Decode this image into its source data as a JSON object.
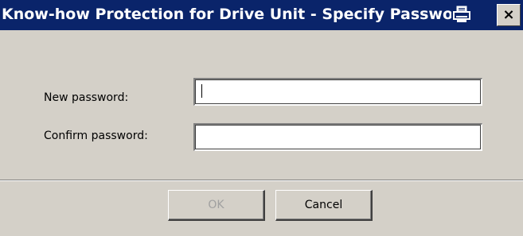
{
  "window": {
    "title": "Know-how Protection for Drive Unit - Specify Password",
    "print_icon": "printer-icon",
    "close_label": "×",
    "close_icon": "close-icon"
  },
  "form": {
    "new_password_label": "New password:",
    "new_password_value": "",
    "confirm_password_label": "Confirm password:",
    "confirm_password_value": ""
  },
  "buttons": {
    "ok_label": "OK",
    "cancel_label": "Cancel"
  },
  "colors": {
    "titlebar": "#0a246a",
    "dialog_background": "#d4d0c8",
    "disabled_text": "#a0a0a0"
  }
}
